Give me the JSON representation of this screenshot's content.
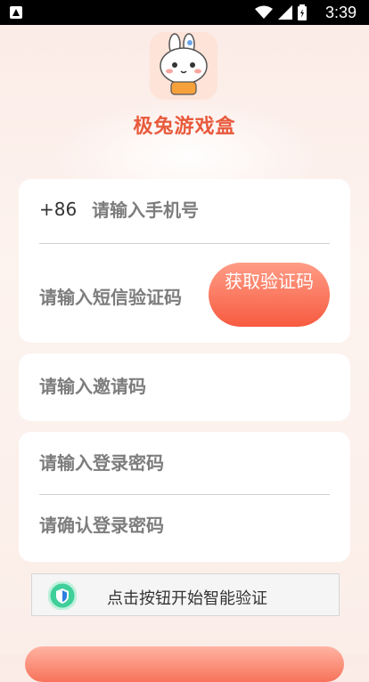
{
  "status_bar": {
    "time": "3:39",
    "icons": [
      "notification-icon",
      "wifi-icon",
      "signal-icon",
      "battery-icon"
    ]
  },
  "app": {
    "name": "极兔游戏盒"
  },
  "form": {
    "country_code": "+86",
    "phone_placeholder": "请输入手机号",
    "sms_code_placeholder": "请输入短信验证码",
    "get_code_label": "获取验证码",
    "invite_code_placeholder": "请输入邀请码",
    "password_placeholder": "请输入登录密码",
    "confirm_password_placeholder": "请确认登录密码"
  },
  "captcha": {
    "label": "点击按钮开始智能验证"
  },
  "colors": {
    "accent": "#f75b40",
    "verify_green": "#3fcf9a"
  }
}
